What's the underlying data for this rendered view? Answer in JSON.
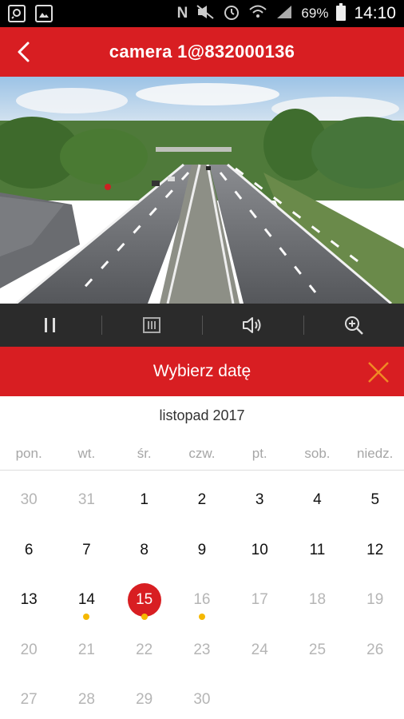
{
  "status_bar": {
    "battery": "69%",
    "time": "14:10",
    "nfc_glyph": "N",
    "left_icons": [
      "search-icon",
      "gallery-icon"
    ],
    "right_icons": [
      "nfc-icon",
      "mute-icon",
      "alarm-icon",
      "wifi-icon",
      "signal-icon",
      "battery-icon"
    ]
  },
  "app_bar": {
    "title": "camera 1@832000136",
    "back_icon": "chevron-left-icon",
    "color": "#d81e22"
  },
  "controls": {
    "items": [
      "pause-icon",
      "record-icon",
      "volume-icon",
      "zoom-in-icon"
    ]
  },
  "date_picker": {
    "title": "Wybierz datę",
    "close_icon": "close-icon",
    "close_color": "#f08a24",
    "month": "listopad 2017",
    "weekdays": [
      "pon.",
      "wt.",
      "śr.",
      "czw.",
      "pt.",
      "sob.",
      "niedz."
    ],
    "selected_day": "15",
    "selected_color": "#d81e22",
    "recording_dot_color": "#f5b800",
    "weeks": [
      [
        "30",
        "31",
        "1",
        "2",
        "3",
        "4",
        "5"
      ],
      [
        "6",
        "7",
        "8",
        "9",
        "10",
        "11",
        "12"
      ],
      [
        "13",
        "14",
        "15",
        "16",
        "17",
        "18",
        "19"
      ],
      [
        "20",
        "21",
        "22",
        "23",
        "24",
        "25",
        "26"
      ],
      [
        "27",
        "28",
        "29",
        "30",
        "",
        "",
        ""
      ]
    ],
    "active_days": [
      "1",
      "2",
      "3",
      "4",
      "5",
      "6",
      "7",
      "8",
      "9",
      "10",
      "11",
      "12",
      "13",
      "14",
      "15"
    ],
    "days_with_recordings": [
      "14",
      "15",
      "16"
    ]
  }
}
